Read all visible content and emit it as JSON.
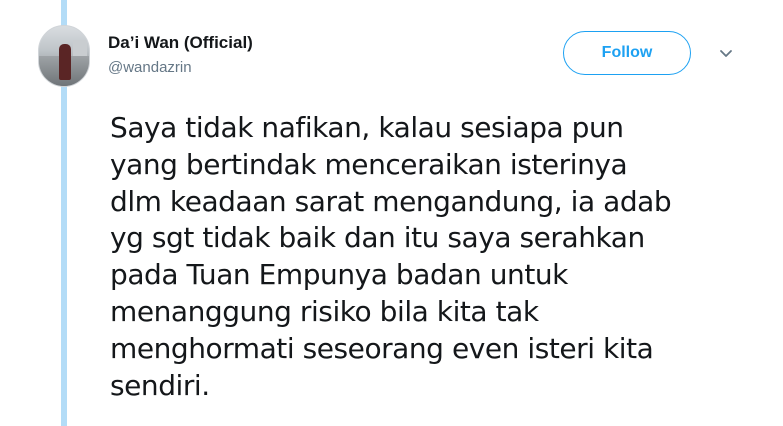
{
  "user": {
    "display_name": "Da’i Wan (Official)",
    "handle": "@wandazrin",
    "avatar_icon": "profile-photo"
  },
  "actions": {
    "follow_label": "Follow",
    "menu_icon": "chevron-down-icon"
  },
  "tweet": {
    "lines": [
      "Saya tidak nafikan, kalau sesiapa pun",
      "yang bertindak menceraikan isterinya",
      "dlm keadaan sarat mengandung, ia adab",
      "yg sgt tidak baik dan itu saya serahkan",
      "pada Tuan Empunya badan untuk",
      "menanggung risiko bila kita tak",
      "menghormati seseorang even isteri kita",
      "sendiri."
    ]
  },
  "colors": {
    "accent": "#1da1f2",
    "thread_line": "#b3dcf7",
    "text": "#14171a",
    "secondary_text": "#657786"
  }
}
